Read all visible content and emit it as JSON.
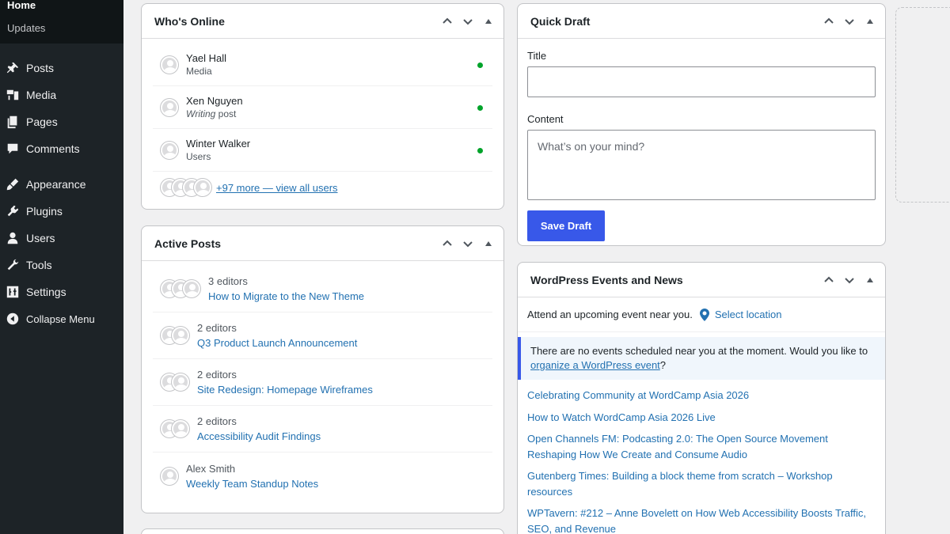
{
  "sidebar": {
    "home": "Home",
    "updates": "Updates",
    "items": [
      {
        "label": "Posts",
        "icon": "pin-icon"
      },
      {
        "label": "Media",
        "icon": "media-icon"
      },
      {
        "label": "Pages",
        "icon": "pages-icon"
      },
      {
        "label": "Comments",
        "icon": "comments-icon"
      },
      {
        "label": "Appearance",
        "icon": "brush-icon"
      },
      {
        "label": "Plugins",
        "icon": "plugin-icon"
      },
      {
        "label": "Users",
        "icon": "user-icon"
      },
      {
        "label": "Tools",
        "icon": "wrench-icon"
      },
      {
        "label": "Settings",
        "icon": "settings-icon"
      }
    ],
    "collapse": "Collapse Menu"
  },
  "whos_online": {
    "title": "Who's Online",
    "users": [
      {
        "name": "Yael Hall",
        "sub": "Media"
      },
      {
        "name": "Xen Nguyen",
        "sub_italic": "Writing",
        "sub_rest": " post"
      },
      {
        "name": "Winter Walker",
        "sub": "Users"
      }
    ],
    "more_link": "+97 more — view all users"
  },
  "active_posts": {
    "title": "Active Posts",
    "posts": [
      {
        "editors": "3 editors",
        "title": "How to Migrate to the New Theme"
      },
      {
        "editors": "2 editors",
        "title": "Q3 Product Launch Announcement"
      },
      {
        "editors": "2 editors",
        "title": "Site Redesign: Homepage Wireframes"
      },
      {
        "editors": "2 editors",
        "title": "Accessibility Audit Findings"
      },
      {
        "editors": "Alex Smith",
        "title": "Weekly Team Standup Notes"
      }
    ]
  },
  "quick_draft": {
    "title": "Quick Draft",
    "title_label": "Title",
    "content_label": "Content",
    "content_placeholder": "What’s on your mind?",
    "save": "Save Draft"
  },
  "events": {
    "title": "WordPress Events and News",
    "attend": "Attend an upcoming event near you.",
    "select_location": "Select location",
    "notice_text": "There are no events scheduled near you at the moment. Would you like to",
    "notice_link": "organize a WordPress event",
    "notice_end": "?",
    "news": [
      "Celebrating Community at WordCamp Asia 2026",
      "How to Watch WordCamp Asia 2026 Live",
      "Open Channels FM: Podcasting 2.0: The Open Source Movement Reshaping How We Create and Consume Audio",
      "Gutenberg Times: Building a block theme from scratch – Workshop resources",
      "WPTavern: #212 – Anne Bovelett on How Web Accessibility Boosts Traffic, SEO, and Revenue"
    ]
  },
  "colors": {
    "sidebar_bg": "#1d2327",
    "link": "#2271b1",
    "primary_button": "#3858e9",
    "online_dot": "#00a32a"
  }
}
